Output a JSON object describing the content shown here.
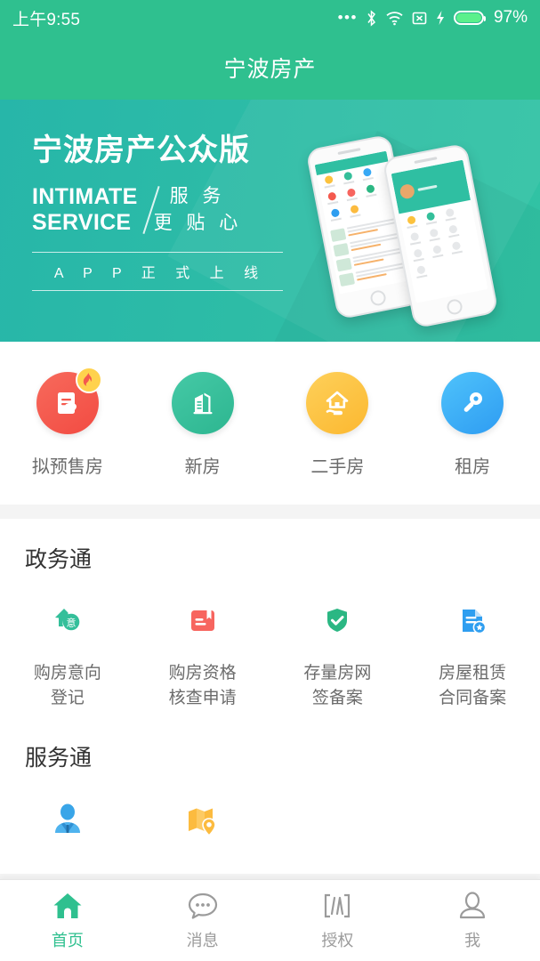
{
  "status_bar": {
    "time": "上午9:55",
    "battery_percent": "97%",
    "icons": [
      "more-dots-icon",
      "bluetooth-icon",
      "wifi-icon",
      "sim-no-signal-icon",
      "charging-bolt-icon",
      "battery-icon"
    ]
  },
  "header": {
    "title": "宁波房产"
  },
  "banner": {
    "headline": "宁波房产公众版",
    "english_line1": "INTIMATE",
    "english_line2": "SERVICE",
    "chinese_line1": "服 务",
    "chinese_line2": "更 贴 心",
    "footer": "A P P 正 式 上 线",
    "bg_color": "#2ebda6"
  },
  "quick_links": [
    {
      "label": "拟预售房",
      "icon": "presale-house-icon",
      "color": "#f4594e",
      "badge": "flame-badge-icon"
    },
    {
      "label": "新房",
      "icon": "new-building-icon",
      "color": "#34bf9a"
    },
    {
      "label": "二手房",
      "icon": "house-in-hand-icon",
      "color": "#fcc23e"
    },
    {
      "label": "租房",
      "icon": "key-icon",
      "color": "#38a9f5"
    }
  ],
  "sections": [
    {
      "title": "政务通",
      "items": [
        {
          "label": "购房意向\n登记",
          "line1": "购房意向",
          "line2": "登记",
          "icon": "house-intent-icon",
          "color": "#34bf9a"
        },
        {
          "label": "购房资格核查申请",
          "line1": "购房资格",
          "line2": "核查申请",
          "icon": "bookmark-document-icon",
          "color": "#f7655f"
        },
        {
          "label": "存量房网签备案",
          "line1": "存量房网",
          "line2": "签备案",
          "icon": "shield-check-icon",
          "color": "#2bb783"
        },
        {
          "label": "房屋租赁合同备案",
          "line1": "房屋租赁",
          "line2": "合同备案",
          "icon": "contract-seal-icon",
          "color": "#2e9ef0"
        }
      ]
    },
    {
      "title": "服务通",
      "items": [
        {
          "label": "",
          "line1": "",
          "line2": "",
          "icon": "agent-person-icon",
          "color": "#39a5e8"
        },
        {
          "label": "",
          "line1": "",
          "line2": "",
          "icon": "map-location-icon",
          "color": "#fcbb3f"
        }
      ]
    }
  ],
  "tabbar": [
    {
      "label": "首页",
      "icon": "home-icon",
      "active": true
    },
    {
      "label": "消息",
      "icon": "chat-bubble-icon",
      "active": false
    },
    {
      "label": "授权",
      "icon": "barcode-icon",
      "active": false
    },
    {
      "label": "我",
      "icon": "person-icon",
      "active": false
    }
  ],
  "theme": {
    "primary": "#2fc08f",
    "banner": "#2ebda6",
    "muted_text": "#6b6b6b",
    "divider": "#f4f4f4"
  }
}
